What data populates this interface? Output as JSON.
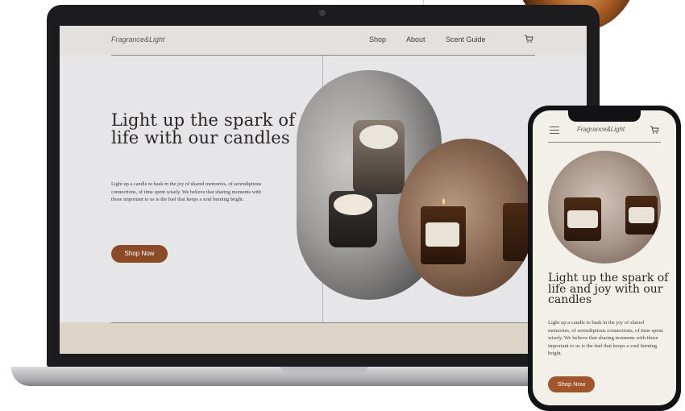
{
  "brand": "Fragrance&Light",
  "nav": {
    "items": [
      "Shop",
      "About",
      "Scent Guide"
    ],
    "cart_icon": "cart-icon"
  },
  "desktop_hero": {
    "title": "Light up the spark of life with our candles",
    "body": "Light up a candle to bask in the joy of shared memories, of serendipitous connections, of time spent wisely. We believe that sharing moments with those important to us is the fuel that keeps a soul burning bright.",
    "button": "Shop Now"
  },
  "mobile_hero": {
    "title": "Light up the spark of life and joy with our candles",
    "body": "Light up a candle to bask in the joy of shared memories, of serendipitous connections, of time spent wisely. We believe that sharing moments with those important to us is the fuel that keeps a soul burning bright.",
    "button": "Shop Now",
    "menu_icon": "hamburger-menu-icon"
  },
  "colors": {
    "accent": "#8a4b26",
    "text": "#2a2623",
    "background": "#e6e6e8"
  }
}
